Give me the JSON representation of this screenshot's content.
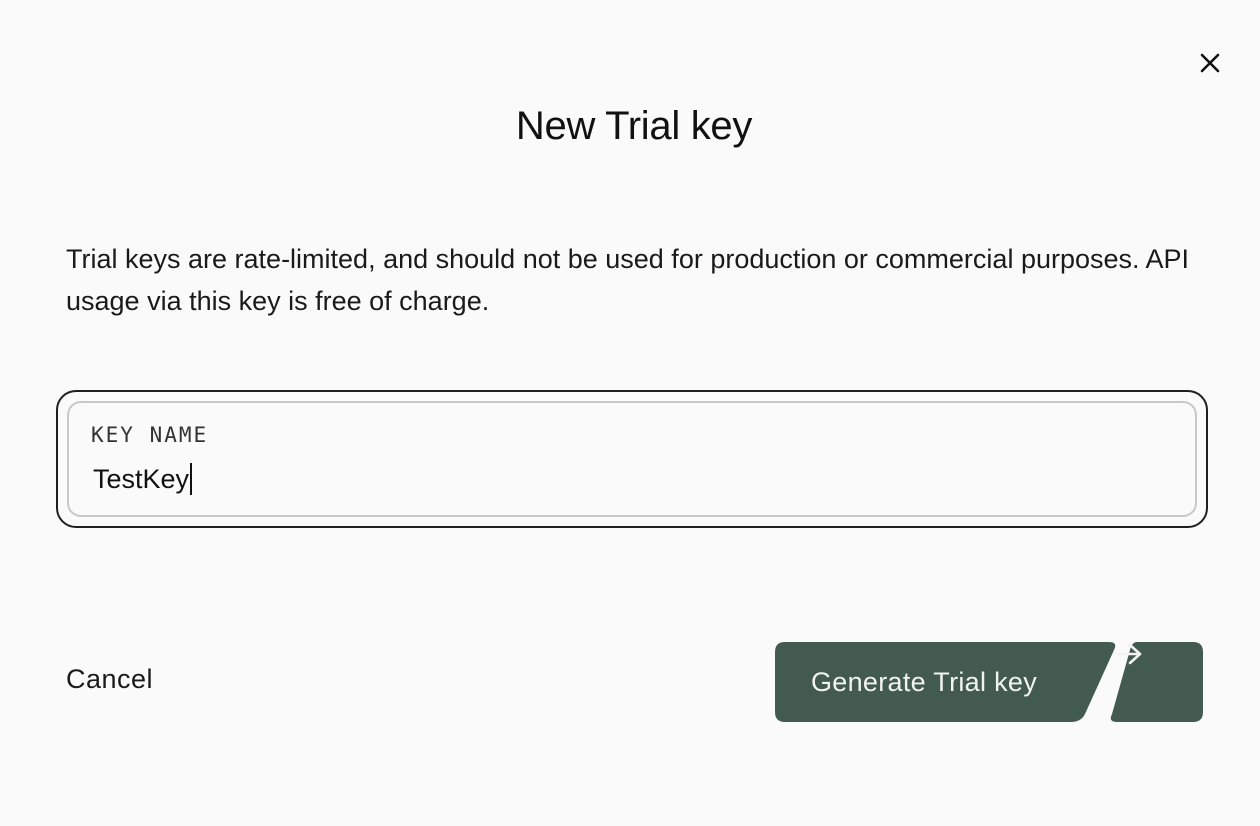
{
  "dialog": {
    "title": "New Trial key",
    "description": "Trial keys are rate-limited, and should not be used for production or commercial purposes. API usage via this key is free of charge.",
    "close_icon": "close-icon"
  },
  "key_field": {
    "label": "KEY NAME",
    "value": "TestKey"
  },
  "actions": {
    "cancel_label": "Cancel",
    "generate_label": "Generate Trial key",
    "arrow_icon": "arrow-right-icon"
  },
  "colors": {
    "background": "#fafafa",
    "primary_button": "#425a4f",
    "text": "#1a1a1a"
  }
}
